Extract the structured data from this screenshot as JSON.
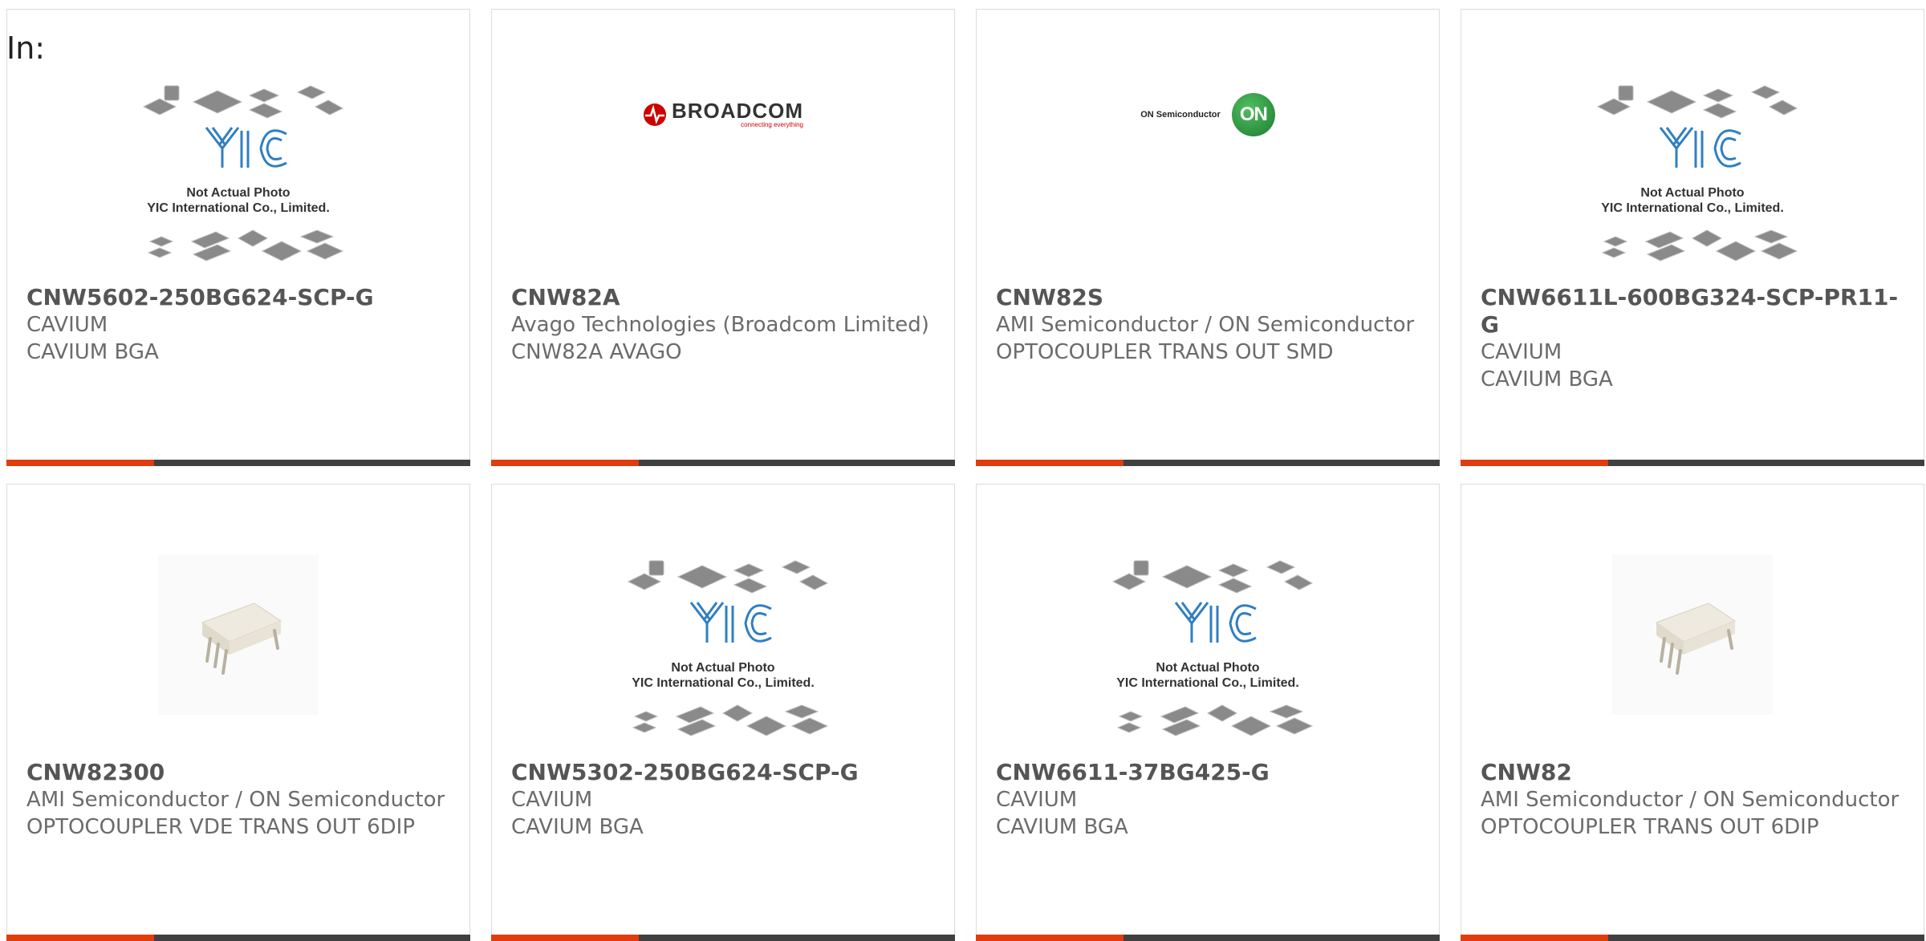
{
  "page": {
    "in_label": "In:"
  },
  "placeholder": {
    "line1": "Not Actual Photo",
    "line2": "YIC International Co., Limited.",
    "logo_text": "YIC"
  },
  "logos": {
    "broadcom": {
      "name": "BROADCOM",
      "tagline": "connecting everything",
      "color": "#cc0000"
    },
    "onsemi": {
      "name": "ON Semiconductor",
      "mark": "ON",
      "color": "#2e8b3e"
    }
  },
  "colors": {
    "accent": "#e03c0e",
    "bar": "#404040",
    "border": "#dcdcdc",
    "text": "#6b6b6b"
  },
  "products": [
    {
      "part": "CNW5602-250BG624-SCP-G",
      "manufacturer": "CAVIUM",
      "description": "CAVIUM BGA",
      "image": "yic-placeholder"
    },
    {
      "part": "CNW82A",
      "manufacturer": "Avago Technologies (Broadcom Limited)",
      "description": "CNW82A AVAGO",
      "image": "broadcom-logo"
    },
    {
      "part": "CNW82S",
      "manufacturer": "AMI Semiconductor / ON Semiconductor",
      "description": "OPTOCOUPLER TRANS OUT SMD",
      "image": "onsemi-logo"
    },
    {
      "part": "CNW6611L-600BG324-SCP-PR11-G",
      "manufacturer": "CAVIUM",
      "description": "CAVIUM BGA",
      "image": "yic-placeholder"
    },
    {
      "part": "CNW82300",
      "manufacturer": "AMI Semiconductor / ON Semiconductor",
      "description": "OPTOCOUPLER VDE TRANS OUT 6DIP",
      "image": "dip-photo"
    },
    {
      "part": "CNW5302-250BG624-SCP-G",
      "manufacturer": "CAVIUM",
      "description": "CAVIUM BGA",
      "image": "yic-placeholder"
    },
    {
      "part": "CNW6611-37BG425-G",
      "manufacturer": "CAVIUM",
      "description": "CAVIUM BGA",
      "image": "yic-placeholder"
    },
    {
      "part": "CNW82",
      "manufacturer": "AMI Semiconductor / ON Semiconductor",
      "description": "OPTOCOUPLER TRANS OUT 6DIP",
      "image": "dip-photo"
    }
  ]
}
